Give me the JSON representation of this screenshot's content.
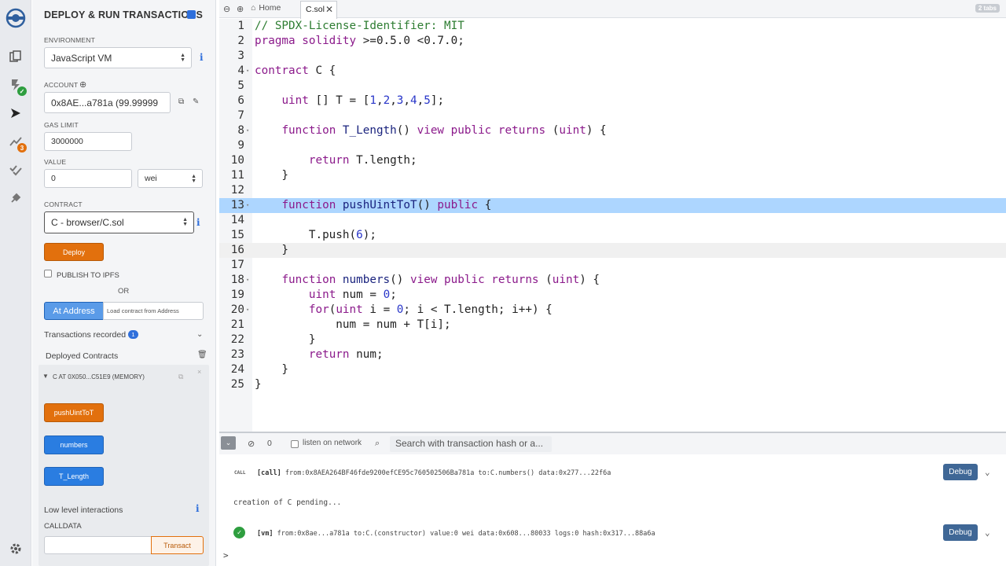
{
  "panel": {
    "title": "DEPLOY & RUN TRANSACTIONS",
    "environment_label": "ENVIRONMENT",
    "environment_value": "JavaScript VM",
    "account_label": "ACCOUNT",
    "account_value": "0x8AE...a781a (99.99999",
    "gas_limit_label": "GAS LIMIT",
    "gas_limit_value": "3000000",
    "value_label": "VALUE",
    "value_value": "0",
    "value_unit": "wei",
    "contract_label": "CONTRACT",
    "contract_value": "C - browser/C.sol",
    "deploy_label": "Deploy",
    "publish_label": "PUBLISH TO IPFS",
    "or_label": "OR",
    "at_address_label": "At Address",
    "at_address_placeholder": "Load contract from Address",
    "transactions_recorded": "Transactions recorded",
    "transactions_count": "1",
    "deployed_contracts": "Deployed Contracts",
    "instance_title": "C AT 0X050...C51E9 (MEMORY)",
    "fn_buttons": [
      "pushUintToT",
      "numbers",
      "T_Length"
    ],
    "low_level": "Low level interactions",
    "calldata_label": "CALLDATA",
    "transact_label": "Transact"
  },
  "rail": {
    "badge_analysis": "3",
    "icons": [
      "remix-logo-icon",
      "file-explorer-icon",
      "solidity-compiler-icon",
      "deploy-run-icon",
      "analysis-icon",
      "testing-icon",
      "plugin-manager-icon",
      "settings-icon"
    ]
  },
  "tabs": {
    "home": "Home",
    "active": "C.sol",
    "count": "2 tabs"
  },
  "editor": {
    "lines": [
      {
        "n": "1",
        "fold": false,
        "parts": [
          [
            "c",
            "// SPDX-License-Identifier: MIT"
          ]
        ]
      },
      {
        "n": "2",
        "fold": false,
        "parts": [
          [
            "k",
            "pragma solidity "
          ],
          [
            "p",
            ">=0.5.0 <0.7.0;"
          ]
        ]
      },
      {
        "n": "3",
        "fold": false,
        "parts": []
      },
      {
        "n": "4",
        "fold": true,
        "parts": [
          [
            "k",
            "contract "
          ],
          [
            "p",
            "C {"
          ]
        ]
      },
      {
        "n": "5",
        "fold": false,
        "parts": []
      },
      {
        "n": "6",
        "fold": false,
        "parts": [
          [
            "p",
            "    "
          ],
          [
            "k",
            "uint "
          ],
          [
            "p",
            "[] T = ["
          ],
          [
            "n",
            "1"
          ],
          [
            "p",
            ","
          ],
          [
            "n",
            "2"
          ],
          [
            "p",
            ","
          ],
          [
            "n",
            "3"
          ],
          [
            "p",
            ","
          ],
          [
            "n",
            "4"
          ],
          [
            "p",
            ","
          ],
          [
            "n",
            "5"
          ],
          [
            "p",
            "];"
          ]
        ]
      },
      {
        "n": "7",
        "fold": false,
        "parts": []
      },
      {
        "n": "8",
        "fold": true,
        "parts": [
          [
            "p",
            "    "
          ],
          [
            "k",
            "function "
          ],
          [
            "f",
            "T_Length"
          ],
          [
            "p",
            "() "
          ],
          [
            "k",
            "view public returns "
          ],
          [
            "p",
            "("
          ],
          [
            "k",
            "uint"
          ],
          [
            "p",
            ") {"
          ]
        ]
      },
      {
        "n": "9",
        "fold": false,
        "parts": []
      },
      {
        "n": "10",
        "fold": false,
        "parts": [
          [
            "p",
            "        "
          ],
          [
            "k",
            "return "
          ],
          [
            "p",
            "T.length;"
          ]
        ]
      },
      {
        "n": "11",
        "fold": false,
        "parts": [
          [
            "p",
            "    }"
          ]
        ]
      },
      {
        "n": "12",
        "fold": false,
        "parts": []
      },
      {
        "n": "13",
        "fold": true,
        "hl": "sel",
        "parts": [
          [
            "p",
            "    "
          ],
          [
            "k",
            "function "
          ],
          [
            "f",
            "pushUintToT"
          ],
          [
            "p",
            "() "
          ],
          [
            "k",
            "public "
          ],
          [
            "p",
            "{"
          ]
        ]
      },
      {
        "n": "14",
        "fold": false,
        "parts": []
      },
      {
        "n": "15",
        "fold": false,
        "parts": [
          [
            "p",
            "        T.push("
          ],
          [
            "n",
            "6"
          ],
          [
            "p",
            ");"
          ]
        ]
      },
      {
        "n": "16",
        "fold": false,
        "hl": "cur",
        "parts": [
          [
            "p",
            "    }"
          ]
        ]
      },
      {
        "n": "17",
        "fold": false,
        "parts": []
      },
      {
        "n": "18",
        "fold": true,
        "parts": [
          [
            "p",
            "    "
          ],
          [
            "k",
            "function "
          ],
          [
            "f",
            "numbers"
          ],
          [
            "p",
            "() "
          ],
          [
            "k",
            "view public returns "
          ],
          [
            "p",
            "("
          ],
          [
            "k",
            "uint"
          ],
          [
            "p",
            ") {"
          ]
        ]
      },
      {
        "n": "19",
        "fold": false,
        "parts": [
          [
            "p",
            "        "
          ],
          [
            "k",
            "uint "
          ],
          [
            "p",
            "num = "
          ],
          [
            "n",
            "0"
          ],
          [
            "p",
            ";"
          ]
        ]
      },
      {
        "n": "20",
        "fold": true,
        "parts": [
          [
            "p",
            "        "
          ],
          [
            "k",
            "for"
          ],
          [
            "p",
            "("
          ],
          [
            "k",
            "uint "
          ],
          [
            "p",
            "i = "
          ],
          [
            "n",
            "0"
          ],
          [
            "p",
            "; i < T.length; i++) {"
          ]
        ]
      },
      {
        "n": "21",
        "fold": false,
        "parts": [
          [
            "p",
            "            num = num + T[i];"
          ]
        ]
      },
      {
        "n": "22",
        "fold": false,
        "parts": [
          [
            "p",
            "        }"
          ]
        ]
      },
      {
        "n": "23",
        "fold": false,
        "parts": [
          [
            "p",
            "        "
          ],
          [
            "k",
            "return "
          ],
          [
            "p",
            "num;"
          ]
        ]
      },
      {
        "n": "24",
        "fold": false,
        "parts": [
          [
            "p",
            "    }"
          ]
        ]
      },
      {
        "n": "25",
        "fold": false,
        "parts": [
          [
            "p",
            "}"
          ]
        ]
      }
    ]
  },
  "terminal": {
    "count": "0",
    "listen_label": "listen on network",
    "search_placeholder": "Search with transaction hash or a...",
    "call_tag": "CALL",
    "call_line": "[call]",
    "call_detail": "from:0x8AEA264BF46fde9200efCE95c760502506Ba781a to:C.numbers() data:0x277...22f6a",
    "pending_line": "creation of C pending...",
    "vm_line": "[vm]",
    "vm_detail": "from:0x8ae...a781a to:C.(constructor) value:0 wei data:0x608...80033 logs:0 hash:0x317...88a6a",
    "debug_label": "Debug",
    "prompt": ">"
  },
  "colors": {
    "accent_orange": "#e2700d",
    "accent_blue": "#2a7de1",
    "selection": "#add6ff",
    "success": "#2e9e3f"
  }
}
